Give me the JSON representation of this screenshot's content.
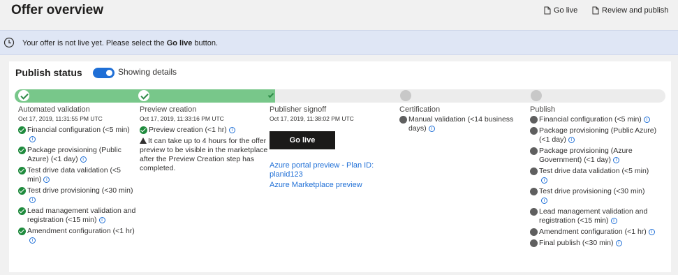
{
  "header": {
    "title": "Offer overview",
    "go_live_label": "Go live",
    "review_label": "Review and publish"
  },
  "banner": {
    "text_before": "Your offer is not live yet. Please select the ",
    "text_bold": "Go live",
    "text_after": " button."
  },
  "publish_status": {
    "title": "Publish status",
    "toggle_label": "Showing details",
    "toggle_on": true
  },
  "progress": {
    "completed_fraction": 0.4
  },
  "stages": {
    "automated": {
      "title": "Automated validation",
      "date": "Oct 17, 2019, 11:31:55 PM UTC",
      "items": [
        "Financial configuration (<5 min)",
        "Package provisioning (Public Azure) (<1 day)",
        "Test drive data validation (<5 min)",
        "Test drive provisioning (<30 min)",
        "Lead management validation and registration (<15 min)",
        "Amendment configuration (<1 hr)"
      ]
    },
    "preview": {
      "title": "Preview creation",
      "date": "Oct 17, 2019, 11:33:16 PM UTC",
      "items": [
        "Preview creation (<1 hr)"
      ],
      "warning": "It can take up to 4 hours for the offer preview to be visible in the marketplace after the Preview Creation step has completed."
    },
    "signoff": {
      "title": "Publisher signoff",
      "date": "Oct 17, 2019, 11:38:02 PM UTC",
      "button": "Go live",
      "links": [
        "Azure portal preview - Plan ID: planid123",
        "Azure Marketplace preview"
      ]
    },
    "certification": {
      "title": "Certification",
      "items": [
        "Manual validation (<14 business days)"
      ]
    },
    "publish": {
      "title": "Publish",
      "items": [
        "Financial configuration (<5 min)",
        "Package provisioning (Public Azure) (<1 day)",
        "Package provisioning (Azure Government) (<1 day)",
        "Test drive data validation (<5 min)",
        "Test drive provisioning (<30 min)",
        "Lead management validation and registration (<15 min)",
        "Amendment configuration (<1 hr)",
        "Final publish (<30 min)"
      ]
    }
  },
  "icons": {
    "banner": "clock-icon",
    "header_buttons": "document-icon",
    "info": "info-icon",
    "warning": "warning-icon",
    "done": "checkmark-icon"
  },
  "colors": {
    "accent": "#1f6fd6",
    "progress_done": "#78c78a",
    "status_ok": "#1f8b3d",
    "status_pending": "#5f5f5f",
    "banner_bg": "#dfe6f5"
  }
}
